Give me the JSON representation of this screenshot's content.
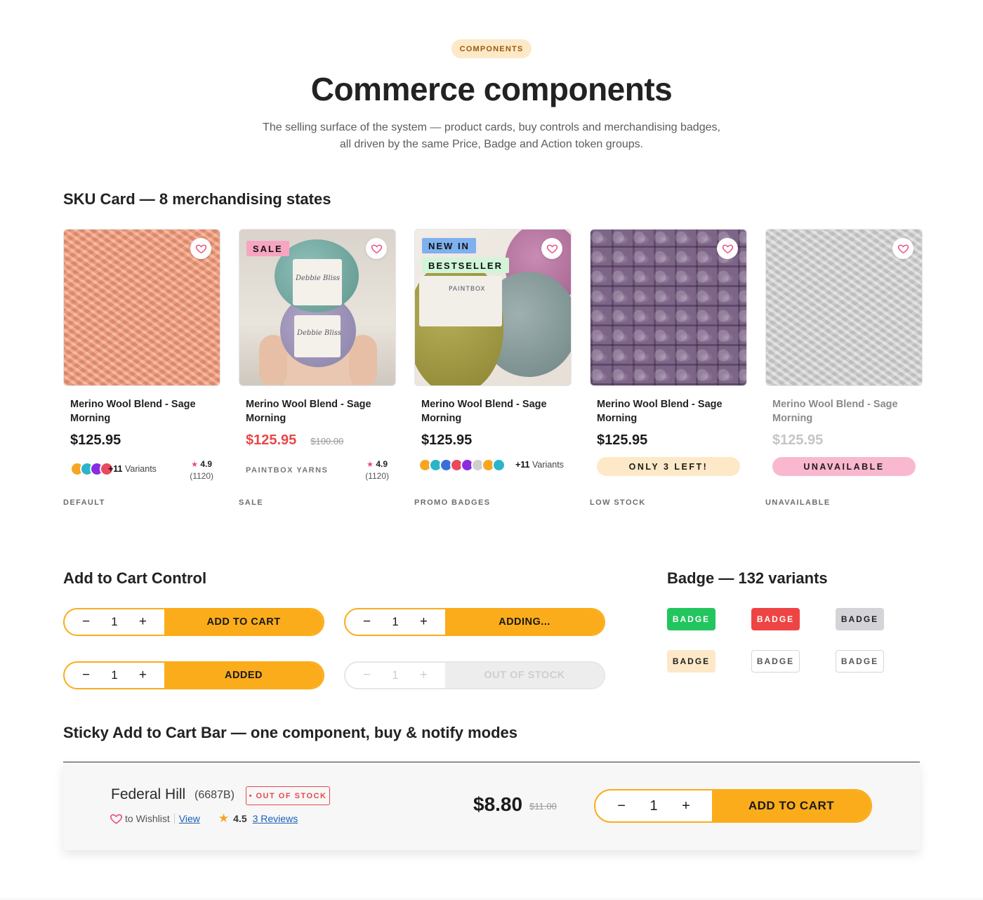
{
  "header": {
    "eyebrow": "COMPONENTS",
    "title": "Commerce components",
    "subtitle_line1": "The selling surface of the system — product cards, buy controls and merchandising badges,",
    "subtitle_line2": "all driven by the same Price, Badge and Action token groups."
  },
  "sku_section": {
    "title": "SKU Card — 8 merchandising states",
    "cards": [
      {
        "name": "Merino Wool Blend - Sage Morning",
        "price": "$125.95",
        "variants_count": "+11",
        "variants_word": "Variants",
        "rating": "4.9",
        "reviews": "(1120)",
        "state_label": "DEFAULT",
        "swatch_colors": [
          "#f6a623",
          "#2bb5c8",
          "#8a2be2",
          "#e84a5f"
        ]
      },
      {
        "name": "Merino Wool Blend - Sage Morning",
        "tag": "SALE",
        "price": "$125.95",
        "old_price": "$100.00",
        "brand": "PAINTBOX YARNS",
        "rating": "4.9",
        "reviews": "(1120)",
        "state_label": "SALE"
      },
      {
        "name": "Merino Wool Blend - Sage Morning",
        "tag1": "NEW IN",
        "tag2": "BESTSELLER",
        "price": "$125.95",
        "variants_count": "+11",
        "variants_word": "Variants",
        "state_label": "PROMO BADGES",
        "swatch_colors": [
          "#f6a623",
          "#2bb5c8",
          "#3a6fd8",
          "#e84a5f",
          "#8a2be2",
          "#cfcfcf",
          "#f6a623",
          "#2bb5c8"
        ]
      },
      {
        "name": "Merino Wool Blend - Sage Morning",
        "price": "$125.95",
        "status": "ONLY 3 LEFT!",
        "state_label": "LOW STOCK"
      },
      {
        "name": "Merino Wool Blend - Sage Morning",
        "price": "$125.95",
        "status": "UNAVAILABLE",
        "state_label": "UNAVAILABLE"
      }
    ]
  },
  "atc_section": {
    "title": "Add to Cart Control",
    "controls": [
      {
        "minus": "−",
        "qty": "1",
        "plus": "+",
        "label": "ADD TO CART"
      },
      {
        "minus": "−",
        "qty": "1",
        "plus": "+",
        "label": "ADDING..."
      },
      {
        "minus": "−",
        "qty": "1",
        "plus": "+",
        "label": "ADDED"
      },
      {
        "minus": "−",
        "qty": "1",
        "plus": "+",
        "label": "OUT OF STOCK"
      }
    ]
  },
  "badge_section": {
    "title": "Badge — 132 variants",
    "badges": [
      {
        "label": "BADGE",
        "bg": "#22c55e",
        "fg": "#ffffff"
      },
      {
        "label": "BADGE",
        "bg": "#ef4444",
        "fg": "#ffffff"
      },
      {
        "label": "BADGE",
        "bg": "#d4d4d8",
        "fg": "#1f1f1f"
      },
      {
        "label": "BADGE",
        "bg": "#fde9c8",
        "fg": "#1f1f1f"
      },
      {
        "label": "BADGE",
        "bg": "#ffffff",
        "fg": "#555555"
      },
      {
        "label": "BADGE",
        "bg": "#ffffff",
        "fg": "#555555"
      }
    ]
  },
  "sticky_section": {
    "title": "Sticky Add to Cart Bar — one component, buy & notify modes",
    "product_name": "Federal Hill",
    "sku": "(6687B)",
    "stock_badge": "• OUT OF STOCK",
    "wishlist_text": "to Wishlist",
    "view_link": "View",
    "rating": "4.5",
    "reviews_link": "3 Reviews",
    "price": "$8.80",
    "old_price": "$11.00",
    "minus": "−",
    "qty": "1",
    "plus": "+",
    "button": "ADD TO CART"
  },
  "colors": {
    "accent": "#fbac1b",
    "sale": "#e8474a",
    "heart": "#e84a7b",
    "low_stock_bg": "#fde9c8",
    "unavailable_bg": "#f9b8cf"
  }
}
